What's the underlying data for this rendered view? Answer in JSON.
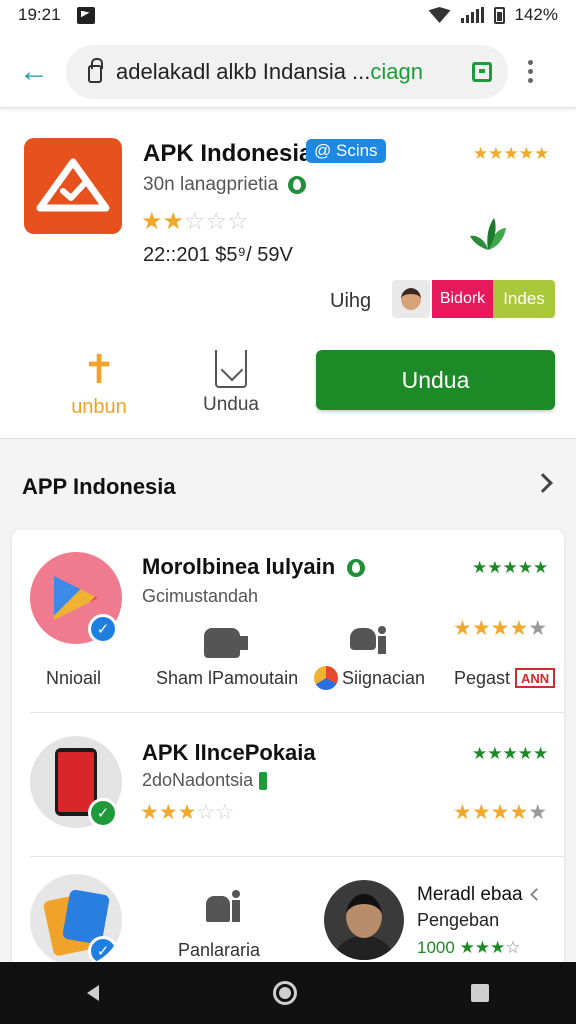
{
  "status_bar": {
    "time": "19:21",
    "battery": "142%"
  },
  "browser": {
    "url_text": "adelakadl alkb Indansia ...",
    "url_accent": "ciagn"
  },
  "app": {
    "title": "APK Indonesia",
    "badge": "@ Scins",
    "top_rating_stars": "★★★★★",
    "subtitle": "30n lanagprietia",
    "rating_value": 2.5,
    "rating_max": 5,
    "price_line": "22::201 $5⁹/ 59V",
    "uihg_label": "Uihg",
    "tag_pink": "Bidork",
    "tag_green": "Indes",
    "action_left_label": "unbun",
    "action_mid_label": "Undua",
    "install_label": "Undua"
  },
  "section": {
    "title": "APP Indonesia"
  },
  "rows": [
    {
      "title": "Morolbinea lulyain",
      "subtitle": "Gcimustandah",
      "stars_green": "★★★★★",
      "stars_orange_value": 4,
      "labels": [
        "Nnioail",
        "Sham lPamoutain",
        "Siignacian",
        "Pegast"
      ],
      "tag": "ANN"
    },
    {
      "title": "APK lIncePokaia",
      "subtitle": "2doNadontsia",
      "stars_green": "★★★★★",
      "rating_value": 3,
      "stars_orange_value": 4
    },
    {
      "label_mid": "Panlararia",
      "name": "Meradl ebaa",
      "subtitle": "Pengeban",
      "count": "1000"
    }
  ],
  "colors": {
    "accent_green": "#1c8a26",
    "app_icon_orange": "#e6511e",
    "star_orange": "#f0a92a",
    "link_teal": "#1a9aa6"
  }
}
